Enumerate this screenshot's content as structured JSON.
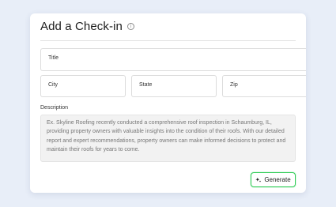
{
  "card": {
    "title": "Add a Check-in",
    "info_icon": "info-icon"
  },
  "fields": {
    "title_label": "Title",
    "city_label": "City",
    "state_label": "State",
    "zip_label": "Zip"
  },
  "description": {
    "label": "Description",
    "placeholder": "Ex. Skyline Roofing recently conducted a comprehensive roof inspection in Schaumburg, IL, providing property owners with valuable insights into the condition of their roofs. With our detailed report and expert recommendations, property owners can make informed decisions to protect and maintain their roofs for years to come."
  },
  "actions": {
    "generate_label": "Generate",
    "generate_icon": "sparkle-icon",
    "accent_color": "#2ecc55"
  }
}
